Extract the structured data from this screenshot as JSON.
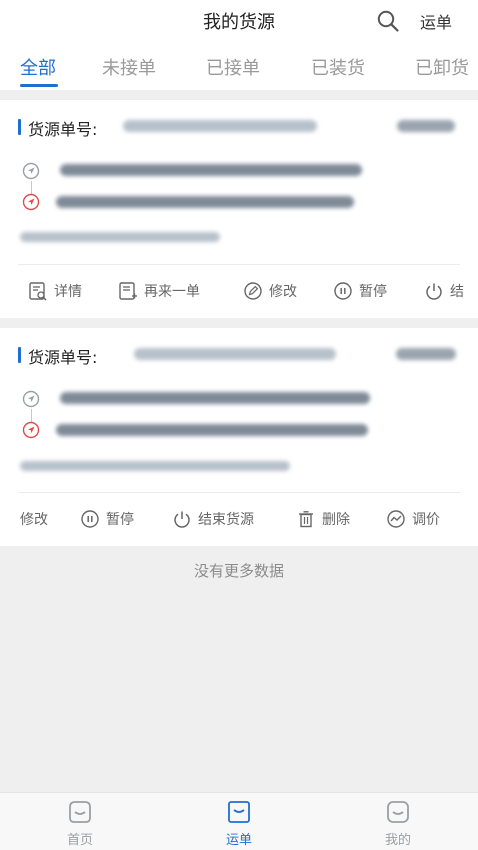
{
  "header": {
    "title": "我的货源",
    "right": "运单"
  },
  "tabs": [
    {
      "label": "全部"
    },
    {
      "label": "未接单"
    },
    {
      "label": "已接单"
    },
    {
      "label": "已装货"
    },
    {
      "label": "已卸货"
    }
  ],
  "cards": [
    {
      "title_label": "货源单号:",
      "actions": [
        "详情",
        "再来一单",
        "修改",
        "暂停",
        "结"
      ]
    },
    {
      "title_label": "货源单号:",
      "actions": [
        "修改",
        "暂停",
        "结束货源",
        "删除",
        "调价"
      ]
    }
  ],
  "footer": {
    "no_more": "没有更多数据"
  },
  "bottom_nav": [
    {
      "label": "首页"
    },
    {
      "label": "运单"
    },
    {
      "label": "我的"
    }
  ],
  "colors": {
    "accent": "#1e6fd1",
    "muted": "#9aa0a6",
    "destination": "#e24b4b"
  }
}
